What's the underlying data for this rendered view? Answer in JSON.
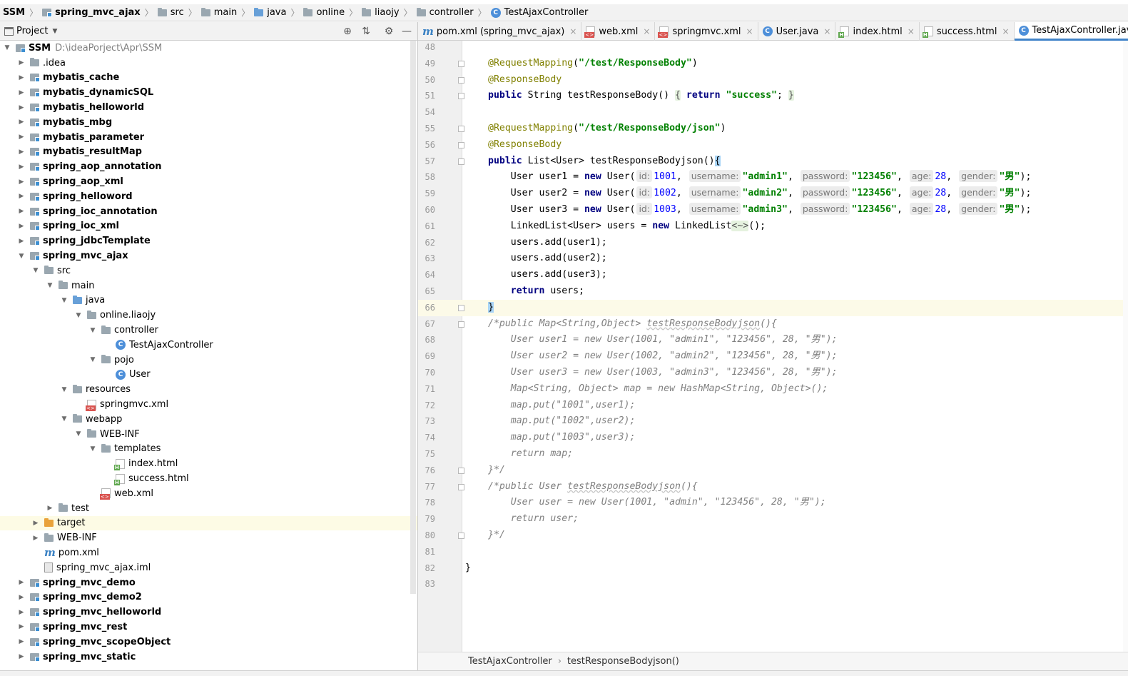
{
  "breadcrumb": [
    {
      "label": "SSM",
      "icon": "none",
      "bold": true
    },
    {
      "label": "spring_mvc_ajax",
      "icon": "module-folder-icon",
      "bold": true
    },
    {
      "label": "src",
      "icon": "folder-icon",
      "bold": false
    },
    {
      "label": "main",
      "icon": "folder-icon",
      "bold": false
    },
    {
      "label": "java",
      "icon": "source-folder-icon",
      "bold": false
    },
    {
      "label": "online",
      "icon": "package-icon",
      "bold": false
    },
    {
      "label": "liaojy",
      "icon": "package-icon",
      "bold": false
    },
    {
      "label": "controller",
      "icon": "package-icon",
      "bold": false
    },
    {
      "label": "TestAjaxController",
      "icon": "class-icon",
      "bold": false
    }
  ],
  "project_panel": {
    "title": "Project",
    "tools": [
      "locate-icon",
      "collapse-all-icon",
      "gear-icon",
      "minimize-icon"
    ]
  },
  "tree": [
    {
      "label": "SSM",
      "path": "D:\\ideaPorject\\Apr\\SSM",
      "indent": 0,
      "arrow": "down",
      "icon": "module",
      "bold": true
    },
    {
      "label": ".idea",
      "indent": 1,
      "arrow": "right",
      "icon": "folder",
      "bold": false
    },
    {
      "label": "mybatis_cache",
      "indent": 1,
      "arrow": "right",
      "icon": "module",
      "bold": true
    },
    {
      "label": "mybatis_dynamicSQL",
      "indent": 1,
      "arrow": "right",
      "icon": "module",
      "bold": true
    },
    {
      "label": "mybatis_helloworld",
      "indent": 1,
      "arrow": "right",
      "icon": "module",
      "bold": true
    },
    {
      "label": "mybatis_mbg",
      "indent": 1,
      "arrow": "right",
      "icon": "module",
      "bold": true
    },
    {
      "label": "mybatis_parameter",
      "indent": 1,
      "arrow": "right",
      "icon": "module",
      "bold": true
    },
    {
      "label": "mybatis_resultMap",
      "indent": 1,
      "arrow": "right",
      "icon": "module",
      "bold": true
    },
    {
      "label": "spring_aop_annotation",
      "indent": 1,
      "arrow": "right",
      "icon": "module",
      "bold": true
    },
    {
      "label": "spring_aop_xml",
      "indent": 1,
      "arrow": "right",
      "icon": "module",
      "bold": true
    },
    {
      "label": "spring_helloword",
      "indent": 1,
      "arrow": "right",
      "icon": "module",
      "bold": true
    },
    {
      "label": "spring_ioc_annotation",
      "indent": 1,
      "arrow": "right",
      "icon": "module",
      "bold": true
    },
    {
      "label": "spring_ioc_xml",
      "indent": 1,
      "arrow": "right",
      "icon": "module",
      "bold": true
    },
    {
      "label": "spring_jdbcTemplate",
      "indent": 1,
      "arrow": "right",
      "icon": "module",
      "bold": true
    },
    {
      "label": "spring_mvc_ajax",
      "indent": 1,
      "arrow": "down",
      "icon": "module",
      "bold": true
    },
    {
      "label": "src",
      "indent": 2,
      "arrow": "down",
      "icon": "folder",
      "bold": false
    },
    {
      "label": "main",
      "indent": 3,
      "arrow": "down",
      "icon": "folder",
      "bold": false
    },
    {
      "label": "java",
      "indent": 4,
      "arrow": "down",
      "icon": "folder-blue",
      "bold": false
    },
    {
      "label": "online.liaojy",
      "indent": 5,
      "arrow": "down",
      "icon": "package",
      "bold": false
    },
    {
      "label": "controller",
      "indent": 6,
      "arrow": "down",
      "icon": "package",
      "bold": false
    },
    {
      "label": "TestAjaxController",
      "indent": 7,
      "arrow": "none",
      "icon": "class",
      "bold": false
    },
    {
      "label": "pojo",
      "indent": 6,
      "arrow": "down",
      "icon": "package",
      "bold": false
    },
    {
      "label": "User",
      "indent": 7,
      "arrow": "none",
      "icon": "class",
      "bold": false
    },
    {
      "label": "resources",
      "indent": 4,
      "arrow": "down",
      "icon": "folder",
      "bold": false
    },
    {
      "label": "springmvc.xml",
      "indent": 5,
      "arrow": "none",
      "icon": "xml",
      "bold": false
    },
    {
      "label": "webapp",
      "indent": 4,
      "arrow": "down",
      "icon": "folder",
      "bold": false
    },
    {
      "label": "WEB-INF",
      "indent": 5,
      "arrow": "down",
      "icon": "folder",
      "bold": false
    },
    {
      "label": "templates",
      "indent": 6,
      "arrow": "down",
      "icon": "folder",
      "bold": false
    },
    {
      "label": "index.html",
      "indent": 7,
      "arrow": "none",
      "icon": "html",
      "bold": false
    },
    {
      "label": "success.html",
      "indent": 7,
      "arrow": "none",
      "icon": "html",
      "bold": false
    },
    {
      "label": "web.xml",
      "indent": 6,
      "arrow": "none",
      "icon": "xml",
      "bold": false
    },
    {
      "label": "test",
      "indent": 3,
      "arrow": "right",
      "icon": "folder",
      "bold": false
    },
    {
      "label": "target",
      "indent": 2,
      "arrow": "right",
      "icon": "folder-orange",
      "bold": false,
      "highlight": true
    },
    {
      "label": "WEB-INF",
      "indent": 2,
      "arrow": "right",
      "icon": "folder",
      "bold": false
    },
    {
      "label": "pom.xml",
      "indent": 2,
      "arrow": "none",
      "icon": "maven",
      "bold": false
    },
    {
      "label": "spring_mvc_ajax.iml",
      "indent": 2,
      "arrow": "none",
      "icon": "iml",
      "bold": false
    },
    {
      "label": "spring_mvc_demo",
      "indent": 1,
      "arrow": "right",
      "icon": "module",
      "bold": true
    },
    {
      "label": "spring_mvc_demo2",
      "indent": 1,
      "arrow": "right",
      "icon": "module",
      "bold": true
    },
    {
      "label": "spring_mvc_helloworld",
      "indent": 1,
      "arrow": "right",
      "icon": "module",
      "bold": true
    },
    {
      "label": "spring_mvc_rest",
      "indent": 1,
      "arrow": "right",
      "icon": "module",
      "bold": true
    },
    {
      "label": "spring_mvc_scopeObject",
      "indent": 1,
      "arrow": "right",
      "icon": "module",
      "bold": true
    },
    {
      "label": "spring_mvc_static",
      "indent": 1,
      "arrow": "right",
      "icon": "module",
      "bold": true
    }
  ],
  "tabs": [
    {
      "label": "pom.xml (spring_mvc_ajax)",
      "icon": "maven",
      "active": false
    },
    {
      "label": "web.xml",
      "icon": "xml",
      "active": false
    },
    {
      "label": "springmvc.xml",
      "icon": "xml",
      "active": false
    },
    {
      "label": "User.java",
      "icon": "class",
      "active": false
    },
    {
      "label": "index.html",
      "icon": "html",
      "active": false
    },
    {
      "label": "success.html",
      "icon": "html",
      "active": false
    },
    {
      "label": "TestAjaxController.java",
      "icon": "class",
      "active": true
    }
  ],
  "tab_close_glyph": "×",
  "code_lines": [
    {
      "n": "48",
      "fold": false,
      "tokens": []
    },
    {
      "n": "49",
      "fold": true,
      "tokens": [
        {
          "t": "ann",
          "v": "@RequestMapping"
        },
        {
          "t": "p",
          "v": "("
        },
        {
          "t": "str",
          "v": "\"/test/ResponseBody\""
        },
        {
          "t": "p",
          "v": ")"
        }
      ]
    },
    {
      "n": "50",
      "fold": true,
      "tokens": [
        {
          "t": "ann",
          "v": "@ResponseBody"
        }
      ]
    },
    {
      "n": "51",
      "fold": true,
      "tokens": [
        {
          "t": "kw",
          "v": "public"
        },
        {
          "t": "p",
          "v": " String testResponseBody() "
        },
        {
          "t": "fold",
          "v": "{"
        },
        {
          "t": "p",
          "v": " "
        },
        {
          "t": "kw",
          "v": "return"
        },
        {
          "t": "p",
          "v": " "
        },
        {
          "t": "str",
          "v": "\"success\""
        },
        {
          "t": "p",
          "v": "; "
        },
        {
          "t": "fold",
          "v": "}"
        }
      ]
    },
    {
      "n": "54",
      "fold": false,
      "tokens": []
    },
    {
      "n": "55",
      "fold": true,
      "tokens": [
        {
          "t": "ann",
          "v": "@RequestMapping"
        },
        {
          "t": "p",
          "v": "("
        },
        {
          "t": "str",
          "v": "\"/test/ResponseBody/json\""
        },
        {
          "t": "p",
          "v": ")"
        }
      ]
    },
    {
      "n": "56",
      "fold": true,
      "tokens": [
        {
          "t": "ann",
          "v": "@ResponseBody"
        }
      ]
    },
    {
      "n": "57",
      "fold": true,
      "tokens": [
        {
          "t": "kw",
          "v": "public"
        },
        {
          "t": "p",
          "v": " List<User> testResponseBodyjson()"
        },
        {
          "t": "brace",
          "v": "{"
        }
      ]
    },
    {
      "n": "58",
      "fold": false,
      "tokens": [
        {
          "t": "p",
          "v": "    User user1 = "
        },
        {
          "t": "kw",
          "v": "new"
        },
        {
          "t": "p",
          "v": " User("
        },
        {
          "t": "hint",
          "v": "id:"
        },
        {
          "t": "num",
          "v": "1001"
        },
        {
          "t": "p",
          "v": ", "
        },
        {
          "t": "hint",
          "v": "username:"
        },
        {
          "t": "str",
          "v": "\"admin1\""
        },
        {
          "t": "p",
          "v": ", "
        },
        {
          "t": "hint",
          "v": "password:"
        },
        {
          "t": "str",
          "v": "\"123456\""
        },
        {
          "t": "p",
          "v": ", "
        },
        {
          "t": "hint",
          "v": "age:"
        },
        {
          "t": "num",
          "v": "28"
        },
        {
          "t": "p",
          "v": ", "
        },
        {
          "t": "hint",
          "v": "gender:"
        },
        {
          "t": "str",
          "v": "\"男\""
        },
        {
          "t": "p",
          "v": ");"
        }
      ]
    },
    {
      "n": "59",
      "fold": false,
      "tokens": [
        {
          "t": "p",
          "v": "    User user2 = "
        },
        {
          "t": "kw",
          "v": "new"
        },
        {
          "t": "p",
          "v": " User("
        },
        {
          "t": "hint",
          "v": "id:"
        },
        {
          "t": "num",
          "v": "1002"
        },
        {
          "t": "p",
          "v": ", "
        },
        {
          "t": "hint",
          "v": "username:"
        },
        {
          "t": "str",
          "v": "\"admin2\""
        },
        {
          "t": "p",
          "v": ", "
        },
        {
          "t": "hint",
          "v": "password:"
        },
        {
          "t": "str",
          "v": "\"123456\""
        },
        {
          "t": "p",
          "v": ", "
        },
        {
          "t": "hint",
          "v": "age:"
        },
        {
          "t": "num",
          "v": "28"
        },
        {
          "t": "p",
          "v": ", "
        },
        {
          "t": "hint",
          "v": "gender:"
        },
        {
          "t": "str",
          "v": "\"男\""
        },
        {
          "t": "p",
          "v": ");"
        }
      ]
    },
    {
      "n": "60",
      "fold": false,
      "tokens": [
        {
          "t": "p",
          "v": "    User user3 = "
        },
        {
          "t": "kw",
          "v": "new"
        },
        {
          "t": "p",
          "v": " User("
        },
        {
          "t": "hint",
          "v": "id:"
        },
        {
          "t": "num",
          "v": "1003"
        },
        {
          "t": "p",
          "v": ", "
        },
        {
          "t": "hint",
          "v": "username:"
        },
        {
          "t": "str",
          "v": "\"admin3\""
        },
        {
          "t": "p",
          "v": ", "
        },
        {
          "t": "hint",
          "v": "password:"
        },
        {
          "t": "str",
          "v": "\"123456\""
        },
        {
          "t": "p",
          "v": ", "
        },
        {
          "t": "hint",
          "v": "age:"
        },
        {
          "t": "num",
          "v": "28"
        },
        {
          "t": "p",
          "v": ", "
        },
        {
          "t": "hint",
          "v": "gender:"
        },
        {
          "t": "str",
          "v": "\"男\""
        },
        {
          "t": "p",
          "v": ");"
        }
      ]
    },
    {
      "n": "61",
      "fold": false,
      "tokens": [
        {
          "t": "p",
          "v": "    LinkedList<User> users = "
        },
        {
          "t": "kw",
          "v": "new"
        },
        {
          "t": "p",
          "v": " LinkedList"
        },
        {
          "t": "fold",
          "v": "<~>"
        },
        {
          "t": "p",
          "v": "();"
        }
      ]
    },
    {
      "n": "62",
      "fold": false,
      "tokens": [
        {
          "t": "p",
          "v": "    users.add(user1);"
        }
      ]
    },
    {
      "n": "63",
      "fold": false,
      "tokens": [
        {
          "t": "p",
          "v": "    users.add(user2);"
        }
      ]
    },
    {
      "n": "64",
      "fold": false,
      "tokens": [
        {
          "t": "p",
          "v": "    users.add(user3);"
        }
      ]
    },
    {
      "n": "65",
      "fold": false,
      "tokens": [
        {
          "t": "p",
          "v": "    "
        },
        {
          "t": "kw",
          "v": "return"
        },
        {
          "t": "p",
          "v": " users;"
        }
      ]
    },
    {
      "n": "66",
      "fold": true,
      "caret": true,
      "tokens": [
        {
          "t": "brace",
          "v": "}"
        }
      ]
    },
    {
      "n": "67",
      "fold": true,
      "tokens": [
        {
          "t": "cmt",
          "v": "/*public Map<String,Object> "
        },
        {
          "t": "cmtu",
          "v": "testResponseBodyjson"
        },
        {
          "t": "cmt",
          "v": "(){"
        }
      ]
    },
    {
      "n": "68",
      "fold": false,
      "tokens": [
        {
          "t": "cmt",
          "v": "    User user1 = new User(1001, \"admin1\", \"123456\", 28, \"男\");"
        }
      ]
    },
    {
      "n": "69",
      "fold": false,
      "tokens": [
        {
          "t": "cmt",
          "v": "    User user2 = new User(1002, \"admin2\", \"123456\", 28, \"男\");"
        }
      ]
    },
    {
      "n": "70",
      "fold": false,
      "tokens": [
        {
          "t": "cmt",
          "v": "    User user3 = new User(1003, \"admin3\", \"123456\", 28, \"男\");"
        }
      ]
    },
    {
      "n": "71",
      "fold": false,
      "tokens": [
        {
          "t": "cmt",
          "v": "    Map<String, Object> map = new HashMap<String, Object>();"
        }
      ]
    },
    {
      "n": "72",
      "fold": false,
      "tokens": [
        {
          "t": "cmt",
          "v": "    map.put(\"1001\",user1);"
        }
      ]
    },
    {
      "n": "73",
      "fold": false,
      "tokens": [
        {
          "t": "cmt",
          "v": "    map.put(\"1002\",user2);"
        }
      ]
    },
    {
      "n": "74",
      "fold": false,
      "tokens": [
        {
          "t": "cmt",
          "v": "    map.put(\"1003\",user3);"
        }
      ]
    },
    {
      "n": "75",
      "fold": false,
      "tokens": [
        {
          "t": "cmt",
          "v": "    return map;"
        }
      ]
    },
    {
      "n": "76",
      "fold": true,
      "tokens": [
        {
          "t": "cmt",
          "v": "}*/"
        }
      ]
    },
    {
      "n": "77",
      "fold": true,
      "tokens": [
        {
          "t": "cmt",
          "v": "/*public User "
        },
        {
          "t": "cmtu",
          "v": "testResponseBodyjson"
        },
        {
          "t": "cmt",
          "v": "(){"
        }
      ]
    },
    {
      "n": "78",
      "fold": false,
      "tokens": [
        {
          "t": "cmt",
          "v": "    User user = new User(1001, \"admin\", \"123456\", 28, \"男\");"
        }
      ]
    },
    {
      "n": "79",
      "fold": false,
      "tokens": [
        {
          "t": "cmt",
          "v": "    return user;"
        }
      ]
    },
    {
      "n": "80",
      "fold": true,
      "tokens": [
        {
          "t": "cmt",
          "v": "}*/"
        }
      ]
    },
    {
      "n": "81",
      "fold": false,
      "tokens": []
    },
    {
      "n": "82",
      "fold": false,
      "outdent": true,
      "tokens": [
        {
          "t": "p",
          "v": "}"
        }
      ]
    },
    {
      "n": "83",
      "fold": false,
      "tokens": []
    }
  ],
  "editor_breadcrumb": [
    "TestAjaxController",
    "testResponseBodyjson()"
  ],
  "colors": {
    "accent": "#4083c9",
    "annotation": "#808000",
    "keyword": "#000080",
    "string": "#008000",
    "number": "#0000ff",
    "comment": "#808080",
    "caret_line": "#fcfae8"
  }
}
